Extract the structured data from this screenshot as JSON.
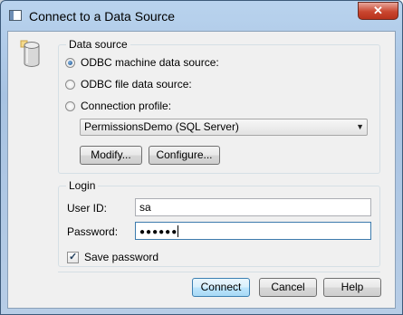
{
  "window": {
    "title": "Connect to a Data Source",
    "close_glyph": "✕"
  },
  "icons": {
    "app": "window-icon",
    "datasource": "database-icon",
    "close": "close-icon",
    "dropdown": "chevron-down-icon"
  },
  "data_source": {
    "legend": "Data source",
    "options": [
      {
        "label": "ODBC machine data source:",
        "selected": true
      },
      {
        "label": "ODBC file data source:",
        "selected": false
      },
      {
        "label": "Connection profile:",
        "selected": false
      }
    ],
    "profile": {
      "value": "PermissionsDemo (SQL Server)",
      "arrow": "▼"
    },
    "modify_label": "Modify...",
    "configure_label": "Configure..."
  },
  "login": {
    "legend": "Login",
    "user_id_label": "User ID:",
    "user_id_value": "sa",
    "password_label": "Password:",
    "password_value": "●●●●●●",
    "save_password_label": "Save password",
    "save_password_checked": true,
    "check_glyph": "✓"
  },
  "actions": {
    "connect": "Connect",
    "cancel": "Cancel",
    "help": "Help"
  }
}
